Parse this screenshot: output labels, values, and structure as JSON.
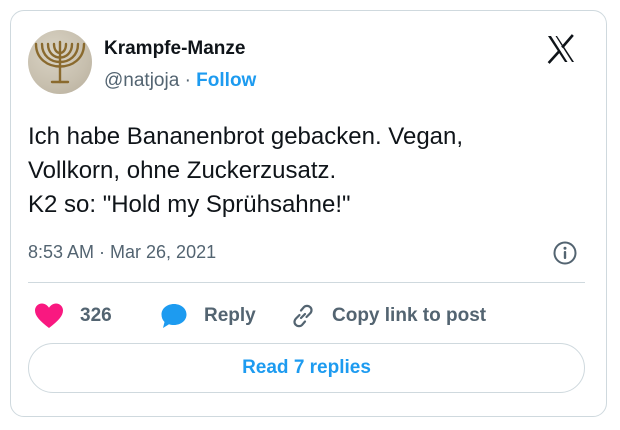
{
  "author": {
    "name": "Krampfe-Manze",
    "handle": "@natjoja",
    "separator": "·",
    "follow_label": "Follow",
    "avatar_icon": "menorah-icon"
  },
  "brand": {
    "logo_icon": "x-logo-icon"
  },
  "tweet": {
    "lines": [
      "Ich habe Bananenbrot gebacken. Vegan,",
      "Vollkorn, ohne Zuckerzusatz.",
      "K2 so: \"Hold my Sprühsahne!\""
    ],
    "timestamp": "8:53 AM · Mar 26, 2021"
  },
  "actions": {
    "like_count": "326",
    "reply_label": "Reply",
    "copy_label": "Copy link to post"
  },
  "read_replies_label": "Read 7 replies",
  "colors": {
    "accent": "#1d9bf0",
    "like": "#f91880",
    "text": "#0f1419",
    "muted": "#536471",
    "border": "#cfd9de"
  }
}
